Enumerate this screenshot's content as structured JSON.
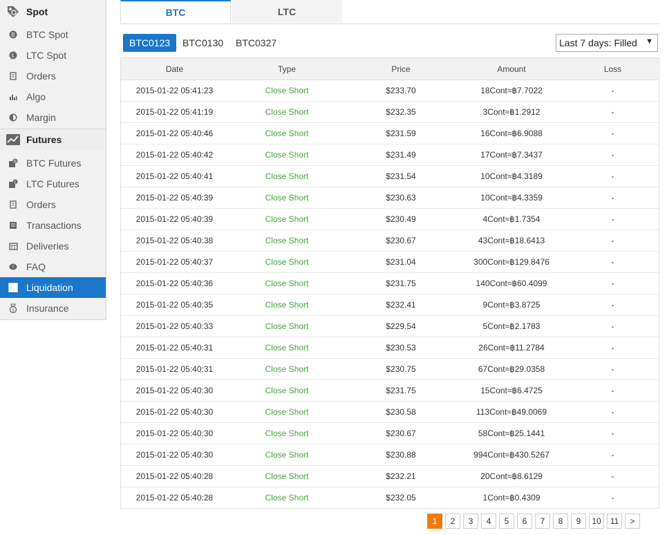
{
  "sidebar": {
    "spot_title": "Spot",
    "spot_items": [
      {
        "label": "BTC Spot",
        "icon": "btc-coin-icon"
      },
      {
        "label": "LTC Spot",
        "icon": "ltc-coin-icon"
      },
      {
        "label": "Orders",
        "icon": "orders-icon"
      },
      {
        "label": "Algo",
        "icon": "algo-chart-icon"
      },
      {
        "label": "Margin",
        "icon": "margin-icon"
      }
    ],
    "futures_title": "Futures",
    "futures_items": [
      {
        "label": "BTC Futures",
        "icon": "btc-futures-icon"
      },
      {
        "label": "LTC Futures",
        "icon": "ltc-futures-icon"
      },
      {
        "label": "Orders",
        "icon": "orders-icon"
      },
      {
        "label": "Transactions",
        "icon": "transactions-icon"
      },
      {
        "label": "Deliveries",
        "icon": "deliveries-icon"
      },
      {
        "label": "FAQ",
        "icon": "faq-icon"
      },
      {
        "label": "Liquidation",
        "icon": "liquidation-icon",
        "active": true
      },
      {
        "label": "Insurance",
        "icon": "insurance-icon"
      }
    ]
  },
  "tabs": [
    {
      "label": "BTC",
      "active": true
    },
    {
      "label": "LTC",
      "active": false
    }
  ],
  "contracts": [
    {
      "label": "BTC0123",
      "active": true
    },
    {
      "label": "BTC0130",
      "active": false
    },
    {
      "label": "BTC0327",
      "active": false
    }
  ],
  "filter": {
    "selected": "Last 7 days: Filled"
  },
  "table": {
    "headers": {
      "date": "Date",
      "type": "Type",
      "price": "Price",
      "amount": "Amount",
      "loss": "Loss"
    },
    "rows": [
      {
        "date": "2015-01-22 05:41:23",
        "type": "Close Short",
        "price": "$233.70",
        "amount": "18Cont≈฿7.7022",
        "loss": "-"
      },
      {
        "date": "2015-01-22 05:41:19",
        "type": "Close Short",
        "price": "$232.35",
        "amount": "3Cont≈฿1.2912",
        "loss": "-"
      },
      {
        "date": "2015-01-22 05:40:46",
        "type": "Close Short",
        "price": "$231.59",
        "amount": "16Cont≈฿6.9088",
        "loss": "-"
      },
      {
        "date": "2015-01-22 05:40:42",
        "type": "Close Short",
        "price": "$231.49",
        "amount": "17Cont≈฿7.3437",
        "loss": "-"
      },
      {
        "date": "2015-01-22 05:40:41",
        "type": "Close Short",
        "price": "$231.54",
        "amount": "10Cont≈฿4.3189",
        "loss": "-"
      },
      {
        "date": "2015-01-22 05:40:39",
        "type": "Close Short",
        "price": "$230.63",
        "amount": "10Cont≈฿4.3359",
        "loss": "-"
      },
      {
        "date": "2015-01-22 05:40:39",
        "type": "Close Short",
        "price": "$230.49",
        "amount": "4Cont≈฿1.7354",
        "loss": "-"
      },
      {
        "date": "2015-01-22 05:40:38",
        "type": "Close Short",
        "price": "$230.67",
        "amount": "43Cont≈฿18.6413",
        "loss": "-"
      },
      {
        "date": "2015-01-22 05:40:37",
        "type": "Close Short",
        "price": "$231.04",
        "amount": "300Cont≈฿129.8476",
        "loss": "-"
      },
      {
        "date": "2015-01-22 05:40:36",
        "type": "Close Short",
        "price": "$231.75",
        "amount": "140Cont≈฿60.4099",
        "loss": "-"
      },
      {
        "date": "2015-01-22 05:40:35",
        "type": "Close Short",
        "price": "$232.41",
        "amount": "9Cont≈฿3.8725",
        "loss": "-"
      },
      {
        "date": "2015-01-22 05:40:33",
        "type": "Close Short",
        "price": "$229.54",
        "amount": "5Cont≈฿2.1783",
        "loss": "-"
      },
      {
        "date": "2015-01-22 05:40:31",
        "type": "Close Short",
        "price": "$230.53",
        "amount": "26Cont≈฿11.2784",
        "loss": "-"
      },
      {
        "date": "2015-01-22 05:40:31",
        "type": "Close Short",
        "price": "$230.75",
        "amount": "67Cont≈฿29.0358",
        "loss": "-"
      },
      {
        "date": "2015-01-22 05:40:30",
        "type": "Close Short",
        "price": "$231.75",
        "amount": "15Cont≈฿6.4725",
        "loss": "-"
      },
      {
        "date": "2015-01-22 05:40:30",
        "type": "Close Short",
        "price": "$230.58",
        "amount": "113Cont≈฿49.0069",
        "loss": "-"
      },
      {
        "date": "2015-01-22 05:40:30",
        "type": "Close Short",
        "price": "$230.67",
        "amount": "58Cont≈฿25.1441",
        "loss": "-"
      },
      {
        "date": "2015-01-22 05:40:30",
        "type": "Close Short",
        "price": "$230.88",
        "amount": "994Cont≈฿430.5267",
        "loss": "-"
      },
      {
        "date": "2015-01-22 05:40:28",
        "type": "Close Short",
        "price": "$232.21",
        "amount": "20Cont≈฿8.6129",
        "loss": "-"
      },
      {
        "date": "2015-01-22 05:40:28",
        "type": "Close Short",
        "price": "$232.05",
        "amount": "1Cont≈฿0.4309",
        "loss": "-"
      }
    ]
  },
  "pagination": {
    "pages": [
      "1",
      "2",
      "3",
      "4",
      "5",
      "6",
      "7",
      "8",
      "9",
      "10",
      "11"
    ],
    "current": "1",
    "next": ">"
  },
  "colors": {
    "accent": "#1a77c9",
    "close_short": "#4aa042",
    "page_active": "#f07a12"
  }
}
